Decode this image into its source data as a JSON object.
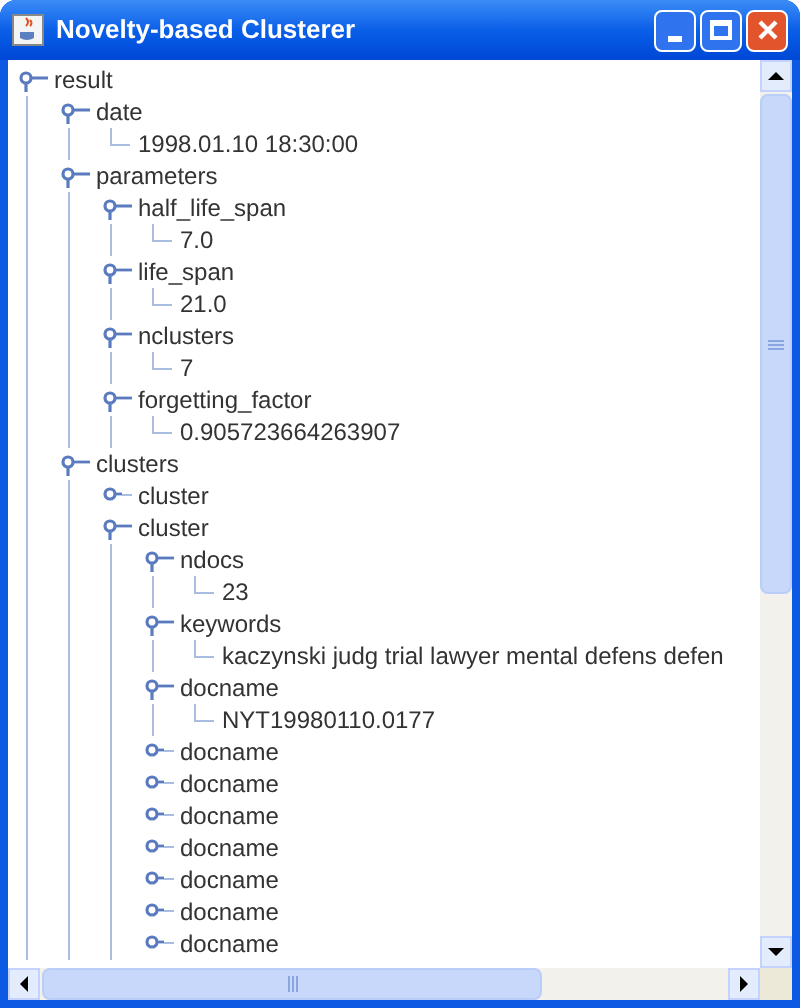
{
  "window": {
    "title": "Novelty-based Clusterer"
  },
  "tree": [
    {
      "kind": "node",
      "label": "result",
      "expanded": true,
      "children": [
        {
          "kind": "node",
          "label": "date",
          "expanded": true,
          "children": [
            {
              "kind": "leaf",
              "label": "1998.01.10 18:30:00"
            }
          ]
        },
        {
          "kind": "node",
          "label": "parameters",
          "expanded": true,
          "children": [
            {
              "kind": "node",
              "label": "half_life_span",
              "expanded": true,
              "children": [
                {
                  "kind": "leaf",
                  "label": "7.0"
                }
              ]
            },
            {
              "kind": "node",
              "label": "life_span",
              "expanded": true,
              "children": [
                {
                  "kind": "leaf",
                  "label": "21.0"
                }
              ]
            },
            {
              "kind": "node",
              "label": "nclusters",
              "expanded": true,
              "children": [
                {
                  "kind": "leaf",
                  "label": "7"
                }
              ]
            },
            {
              "kind": "node",
              "label": "forgetting_factor",
              "expanded": true,
              "children": [
                {
                  "kind": "leaf",
                  "label": "0.905723664263907"
                }
              ]
            }
          ]
        },
        {
          "kind": "node",
          "label": "clusters",
          "expanded": true,
          "children": [
            {
              "kind": "node",
              "label": "cluster",
              "expanded": false
            },
            {
              "kind": "node",
              "label": "cluster",
              "expanded": true,
              "children": [
                {
                  "kind": "node",
                  "label": "ndocs",
                  "expanded": true,
                  "children": [
                    {
                      "kind": "leaf",
                      "label": "23"
                    }
                  ]
                },
                {
                  "kind": "node",
                  "label": "keywords",
                  "expanded": true,
                  "children": [
                    {
                      "kind": "leaf",
                      "label": "kaczynski judg trial lawyer mental defens defen"
                    }
                  ]
                },
                {
                  "kind": "node",
                  "label": "docname",
                  "expanded": true,
                  "children": [
                    {
                      "kind": "leaf",
                      "label": "NYT19980110.0177"
                    }
                  ]
                },
                {
                  "kind": "node",
                  "label": "docname",
                  "expanded": false
                },
                {
                  "kind": "node",
                  "label": "docname",
                  "expanded": false
                },
                {
                  "kind": "node",
                  "label": "docname",
                  "expanded": false
                },
                {
                  "kind": "node",
                  "label": "docname",
                  "expanded": false
                },
                {
                  "kind": "node",
                  "label": "docname",
                  "expanded": false
                },
                {
                  "kind": "node",
                  "label": "docname",
                  "expanded": false
                },
                {
                  "kind": "node",
                  "label": "docname",
                  "expanded": false
                }
              ]
            }
          ]
        }
      ]
    }
  ]
}
